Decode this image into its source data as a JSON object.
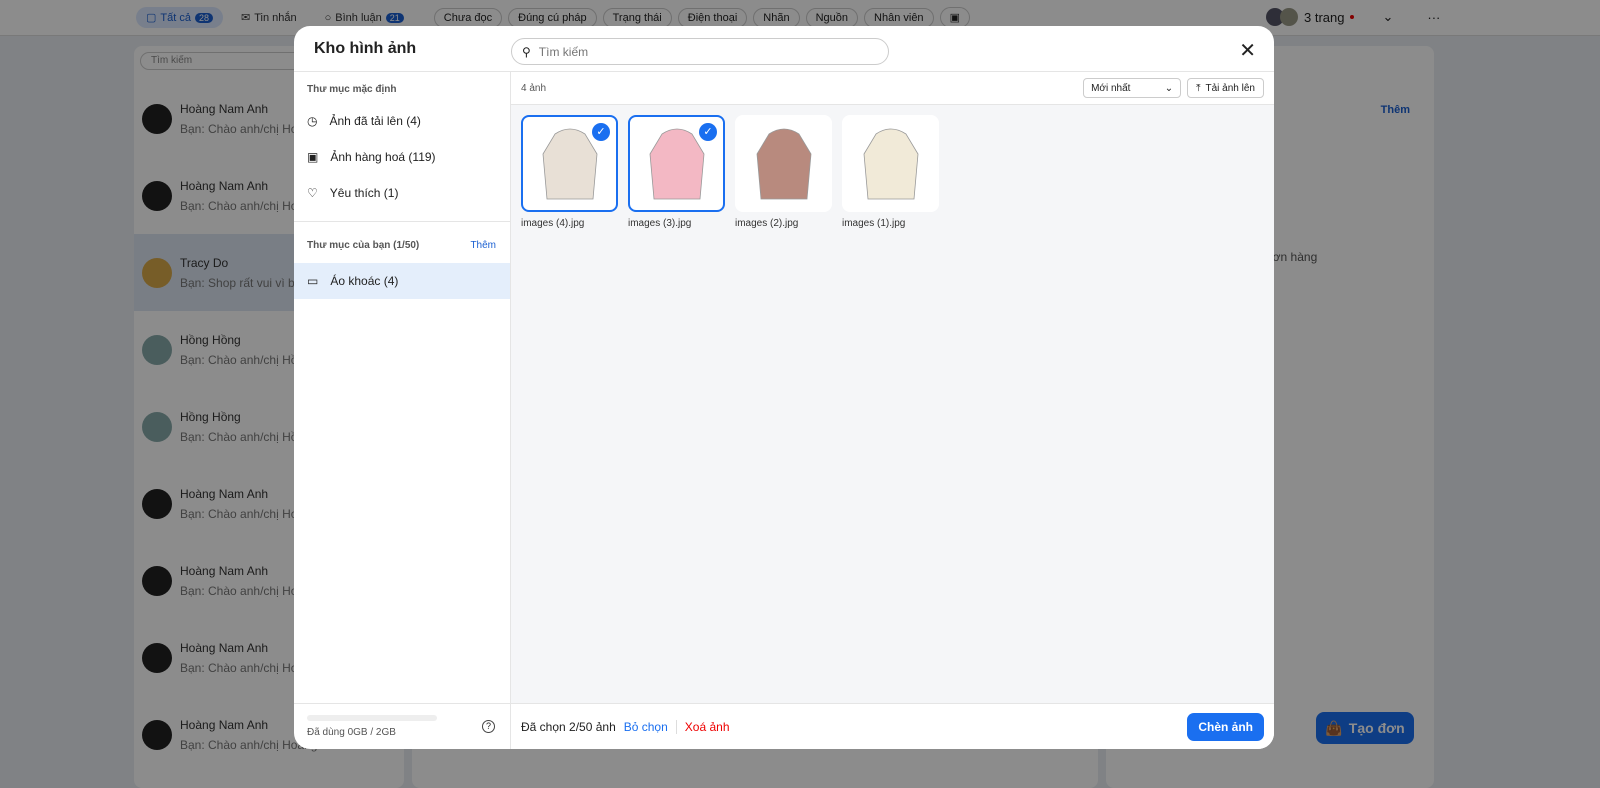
{
  "topbar": {
    "tabs": [
      {
        "label": "Tất cả",
        "count": "28"
      },
      {
        "label": "Tin nhắn"
      },
      {
        "label": "Bình luận",
        "count": "21"
      }
    ],
    "filters": [
      "Chưa đọc",
      "Đúng cú pháp",
      "Trạng thái",
      "Điện thoại",
      "Nhãn",
      "Nguồn",
      "Nhân viên"
    ],
    "pages_label": "3 trang"
  },
  "chat_list": {
    "search_placeholder": "Tìm kiếm",
    "items": [
      {
        "name": "Hoàng Nam Anh",
        "preview": "Bạn: Chào anh/chị Ho"
      },
      {
        "name": "Hoàng Nam Anh",
        "preview": "Bạn: Chào anh/chị Ho"
      },
      {
        "name": "Tracy Do",
        "preview": "Bạn: Shop rất vui vì b"
      },
      {
        "name": "Hồng Hồng",
        "preview": "Bạn: Chào anh/chị Hồ"
      },
      {
        "name": "Hồng Hồng",
        "preview": "Bạn: Chào anh/chị Hồ"
      },
      {
        "name": "Hoàng Nam Anh",
        "preview": "Bạn: Chào anh/chị Ho"
      },
      {
        "name": "Hoàng Nam Anh",
        "preview": "Bạn: Chào anh/chị Ho"
      },
      {
        "name": "Hoàng Nam Anh",
        "preview": "Bạn: Chào anh/chị Ho"
      },
      {
        "name": "Hoàng Nam Anh",
        "preview": "Bạn: Chào anh/chị Hoàng Nam Anh"
      }
    ]
  },
  "right_panel": {
    "more": "Thêm",
    "empty": "đơn hàng",
    "create_order": "Tạo đơn"
  },
  "modal": {
    "title": "Kho hình ảnh",
    "search_placeholder": "Tìm kiếm",
    "default_folders_title": "Thư mục mặc định",
    "default_folders": [
      "Ảnh đã tải lên (4)",
      "Ảnh hàng hoá (119)",
      "Yêu thích (1)"
    ],
    "your_folders_title": "Thư mục của bạn (1/50)",
    "add_folder": "Thêm",
    "your_folders": [
      "Áo khoác (4)"
    ],
    "usage": "Đã dùng 0GB / 2GB",
    "usage_fraction": 0,
    "count_label": "4 ảnh",
    "sort": "Mới nhất",
    "upload": "Tải ảnh lên",
    "images": [
      {
        "name": "images (4).jpg",
        "selected": true,
        "color": "#e8e0d6"
      },
      {
        "name": "images (3).jpg",
        "selected": true,
        "color": "#f3b8c4"
      },
      {
        "name": "images (2).jpg",
        "selected": false,
        "color": "#b88a7e"
      },
      {
        "name": "images (1).jpg",
        "selected": false,
        "color": "#f1ead8"
      }
    ],
    "selected_label": "Đã chọn 2/50 ảnh",
    "deselect": "Bỏ chọn",
    "delete": "Xoá ảnh",
    "insert": "Chèn ảnh"
  }
}
